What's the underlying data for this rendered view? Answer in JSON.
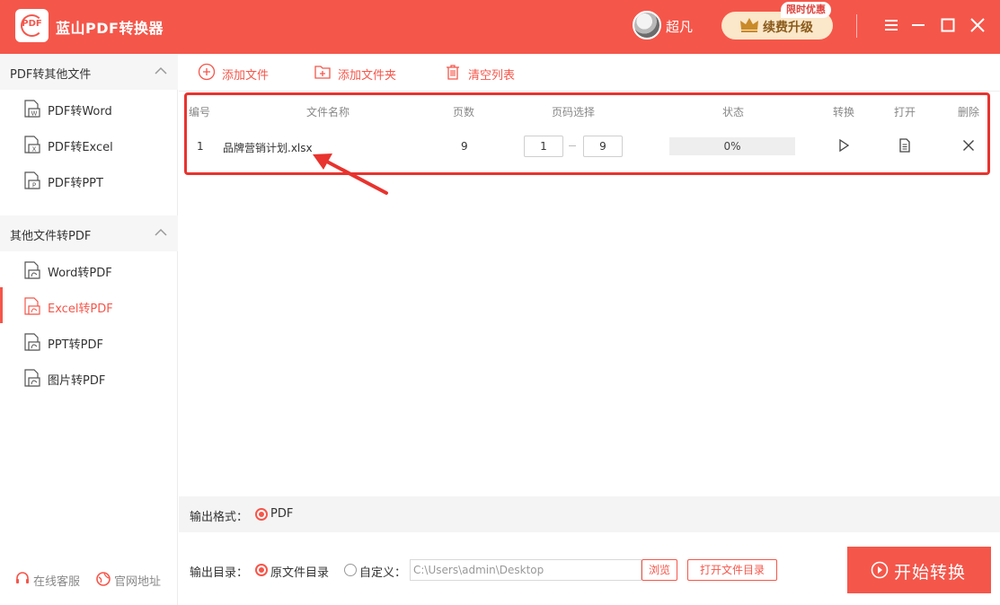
{
  "app": {
    "title": "蓝山PDF转换器",
    "logo_text": "PDF",
    "username": "超凡",
    "upgrade_label": "续费升级",
    "promo_badge": "限时优惠"
  },
  "sidebar": {
    "groups": [
      {
        "title": "PDF转其他文件",
        "items": [
          {
            "label": "PDF转Word",
            "icon": "word-doc-icon"
          },
          {
            "label": "PDF转Excel",
            "icon": "excel-doc-icon"
          },
          {
            "label": "PDF转PPT",
            "icon": "ppt-doc-icon"
          }
        ]
      },
      {
        "title": "其他文件转PDF",
        "items": [
          {
            "label": "Word转PDF",
            "icon": "pdf-doc-icon"
          },
          {
            "label": "Excel转PDF",
            "icon": "pdf-doc-icon",
            "active": true
          },
          {
            "label": "PPT转PDF",
            "icon": "pdf-doc-icon"
          },
          {
            "label": "图片转PDF",
            "icon": "pdf-doc-icon"
          }
        ]
      }
    ],
    "footer": {
      "service": "在线客服",
      "website": "官网地址"
    }
  },
  "toolbar": {
    "add_file": "添加文件",
    "add_folder": "添加文件夹",
    "clear_list": "清空列表"
  },
  "table": {
    "headers": {
      "index": "编号",
      "name": "文件名称",
      "pages": "页数",
      "page_range": "页码选择",
      "status": "状态",
      "convert": "转换",
      "open": "打开",
      "delete": "删除"
    },
    "rows": [
      {
        "index": "1",
        "name": "品牌营销计划.xlsx",
        "pages": "9",
        "page_from": "1",
        "page_to": "9",
        "status": "0%",
        "progress": 0
      }
    ]
  },
  "output": {
    "format_label": "输出格式：",
    "format_value": "PDF",
    "dir_label": "输出目录：",
    "option_original": "原文件目录",
    "option_custom": "自定义：",
    "custom_path": "C:\\Users\\admin\\Desktop",
    "browse": "浏览",
    "open_folder": "打开文件目录"
  },
  "start_button": "开始转换",
  "colors": {
    "accent": "#f5564a",
    "annotation": "#e8332e",
    "upgrade_bg": "#fbe7c9"
  }
}
